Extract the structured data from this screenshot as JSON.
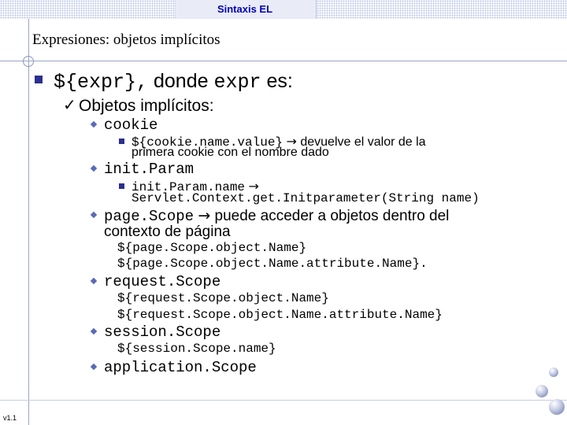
{
  "header": {
    "title": "Sintaxis EL"
  },
  "slide": {
    "title": "Expresiones: objetos implícitos",
    "main_bullet": {
      "code1": "${expr},",
      "text1": "donde",
      "code2": "expr",
      "text2": "es:"
    },
    "sub_heading": "Objetos implícitos:",
    "items": [
      {
        "name": "cookie"
      },
      {
        "name": "init.Param"
      },
      {
        "name": "page.Scope"
      },
      {
        "name": "request.Scope"
      },
      {
        "name": "session.Scope"
      },
      {
        "name": "application.Scope"
      }
    ],
    "cookie_detail": {
      "code": "${cookie.name.value}",
      "text_a": "devuelve el valor de la",
      "text_b": "primera cookie con el nombre dado"
    },
    "initparam_detail": {
      "code_a": "init.Param.name",
      "code_b": "Servlet.Context.get.Initparameter(String name)"
    },
    "pagescope_text": {
      "a": "puede acceder a objetos dentro del",
      "b": "contexto de página"
    },
    "pagescope_examples": [
      "${page.Scope.object.Name}",
      "${page.Scope.object.Name.attribute.Name}."
    ],
    "requestscope_examples": [
      "${request.Scope.object.Name}",
      "${request.Scope.object.Name.attribute.Name}"
    ],
    "sessionscope_examples": [
      "${session.Scope.name}"
    ]
  },
  "footer": {
    "version": "v1.1"
  },
  "icons": {
    "main_bullet": "square-bullet-icon",
    "sub_bullet": "checkmark-icon",
    "item_bullet": "diamond-bullet-icon",
    "detail_bullet": "small-square-bullet-icon",
    "arrow": "arrow-right-icon"
  },
  "colors": {
    "header_text": "#0000b8",
    "bullet": "#2b2f8f",
    "diamond": "#5a6ab8",
    "lines": "#9aa4c8"
  }
}
